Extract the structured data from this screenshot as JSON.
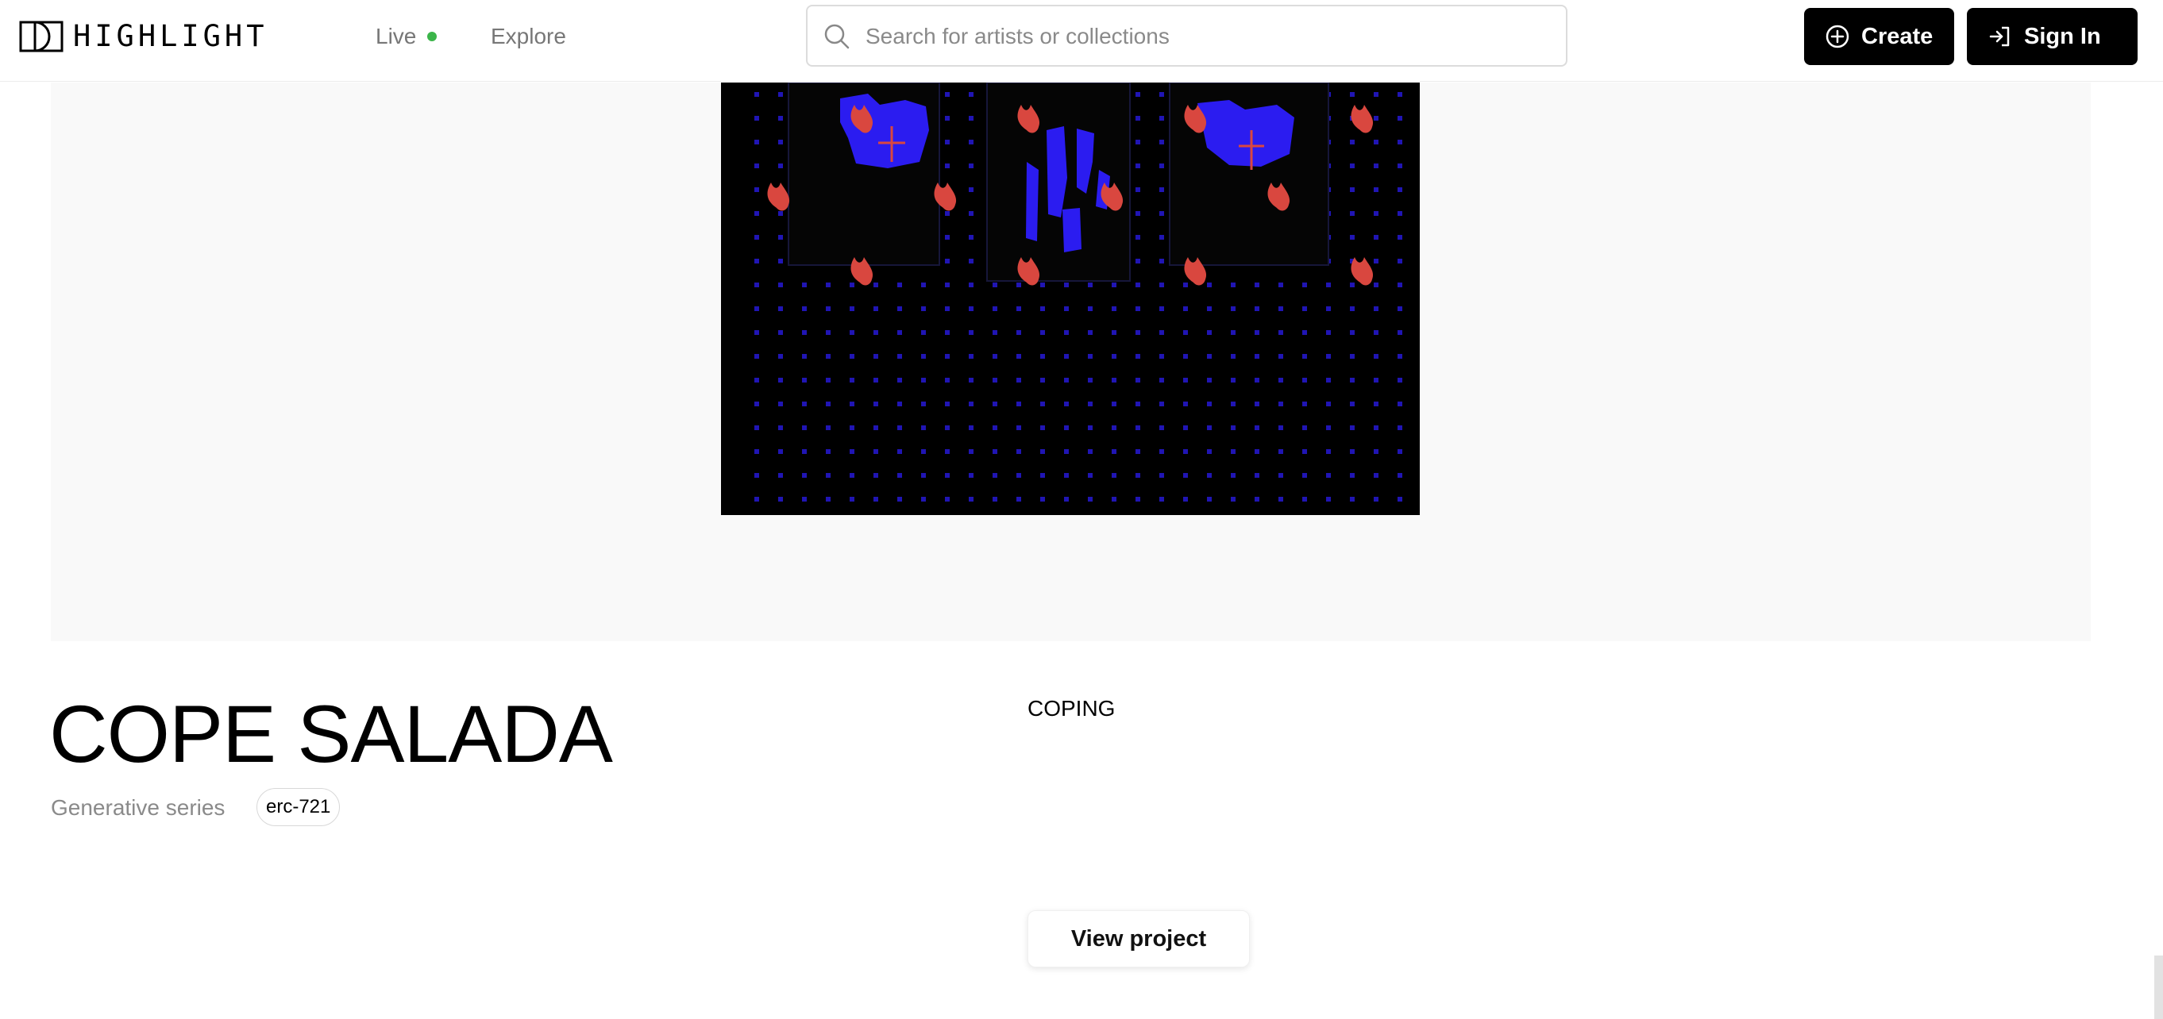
{
  "brand": {
    "name": "HIGHLIGHT"
  },
  "nav": {
    "live_label": "Live",
    "explore_label": "Explore"
  },
  "search": {
    "placeholder": "Search for artists or collections"
  },
  "actions": {
    "create_label": "Create",
    "signin_label": "Sign In"
  },
  "collection": {
    "title": "COPE SALADA",
    "type": "Generative series",
    "standard": "erc-721",
    "description": "COPING",
    "view_button": "View project"
  },
  "colors": {
    "live_indicator": "#3bb54a",
    "button_bg": "#000000",
    "artwork_bg": "#000000",
    "artwork_blue": "#2b1cf0",
    "artwork_flame": "#d9473f"
  },
  "icons": [
    "highlight-logo-icon",
    "search-icon",
    "plus-circle-icon",
    "sign-in-icon"
  ]
}
